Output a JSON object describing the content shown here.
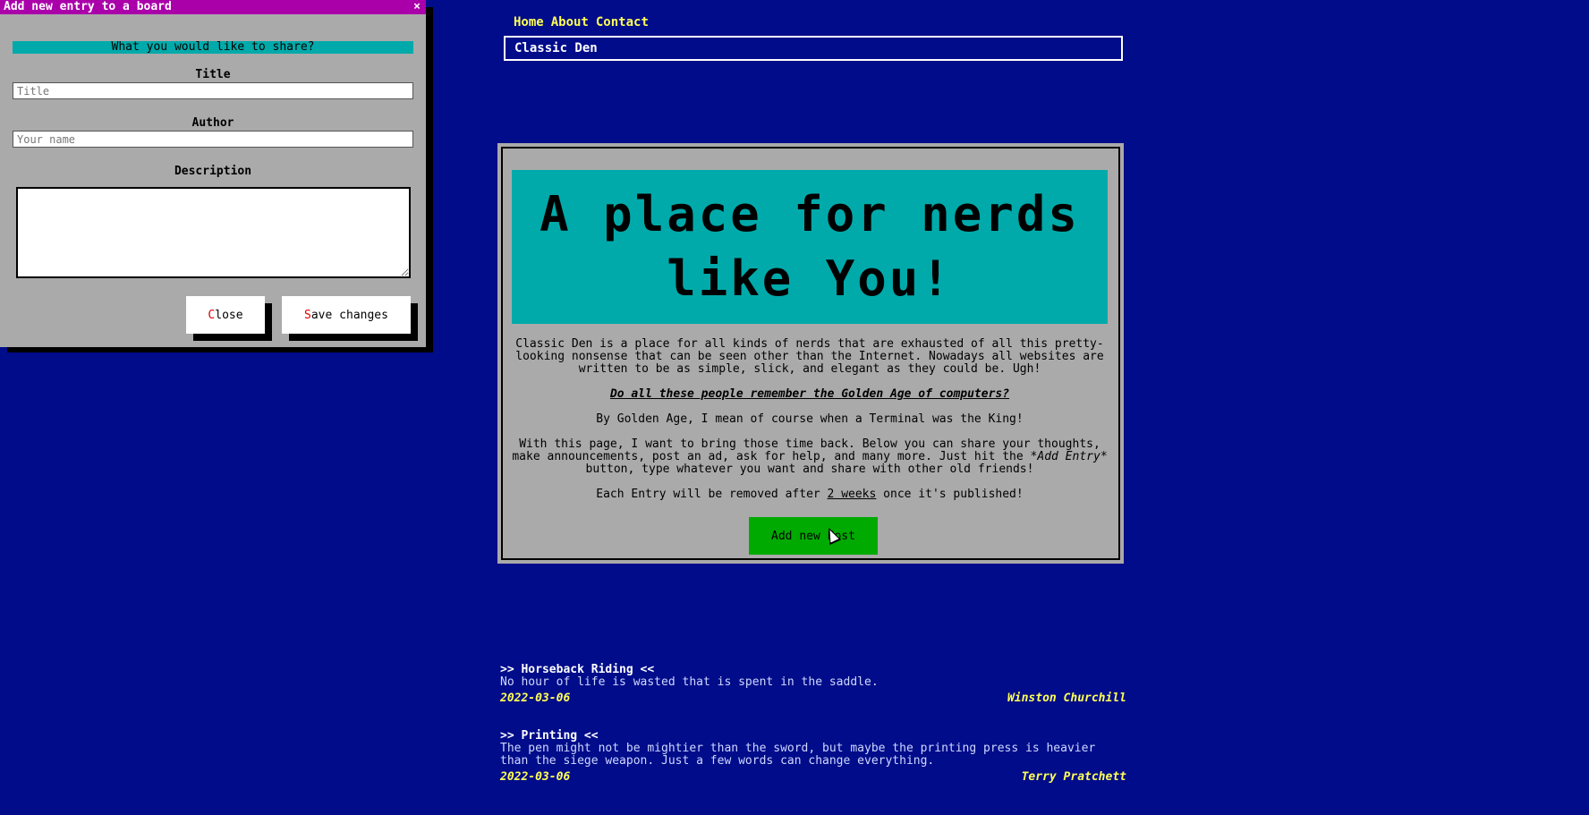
{
  "nav": {
    "items": [
      "Home",
      "About",
      "Contact"
    ],
    "brand": "Classic Den"
  },
  "hero": {
    "headline_line1": "A place for nerds",
    "headline_line2": "like You!",
    "intro": "Classic Den is a place for all kinds of nerds that are exhausted of all this pretty-looking nonsense that can be seen other than the Internet. Nowadays all websites are written to be as simple, slick, and elegant as they could be. Ugh!",
    "question": "Do all these people remember the Golden Age of computers?",
    "golden_age": "By Golden Age, I mean of course when a Terminal was the King!",
    "invite_part1": "With this page, I want to bring those time back. Below you can share your thoughts, make announcements, post an ad, ask for help, and many more. Just hit the ",
    "invite_emph": "*Add Entry*",
    "invite_part2": " button, type whatever you want and share with other old friends!",
    "removal_part1": "Each Entry will be removed after ",
    "removal_emph": "2 weeks",
    "removal_part2": " once it's published!",
    "add_button": "Add new Post"
  },
  "posts": [
    {
      "title": ">> Horseback Riding <<",
      "body": "No hour of life is wasted that is spent in the saddle.",
      "date": "2022-03-06",
      "author": "Winston Churchill"
    },
    {
      "title": ">> Printing <<",
      "body": "The pen might not be mightier than the sword, but maybe the printing press is heavier\nthan the siege weapon. Just a few words can change everything.",
      "date": "2022-03-06",
      "author": "Terry Pratchett"
    }
  ],
  "modal": {
    "title": "Add new entry to a board",
    "close_x": "×",
    "heading": "What you would like to share?",
    "title_label": "Title",
    "title_placeholder": "Title",
    "author_label": "Author",
    "author_placeholder": "Your name",
    "description_label": "Description",
    "description_value": "",
    "close_hotkey": "C",
    "close_rest": "lose",
    "save_hotkey": "S",
    "save_rest": "ave changes"
  },
  "colors": {
    "background": "#000c8a",
    "nav_link": "#ffff55",
    "panel": "#aaaaaa",
    "hero_bg": "#00aaaa",
    "add_button": "#00aa00",
    "modal_titlebar": "#aa00aa",
    "hotkey": "#dd0000"
  }
}
